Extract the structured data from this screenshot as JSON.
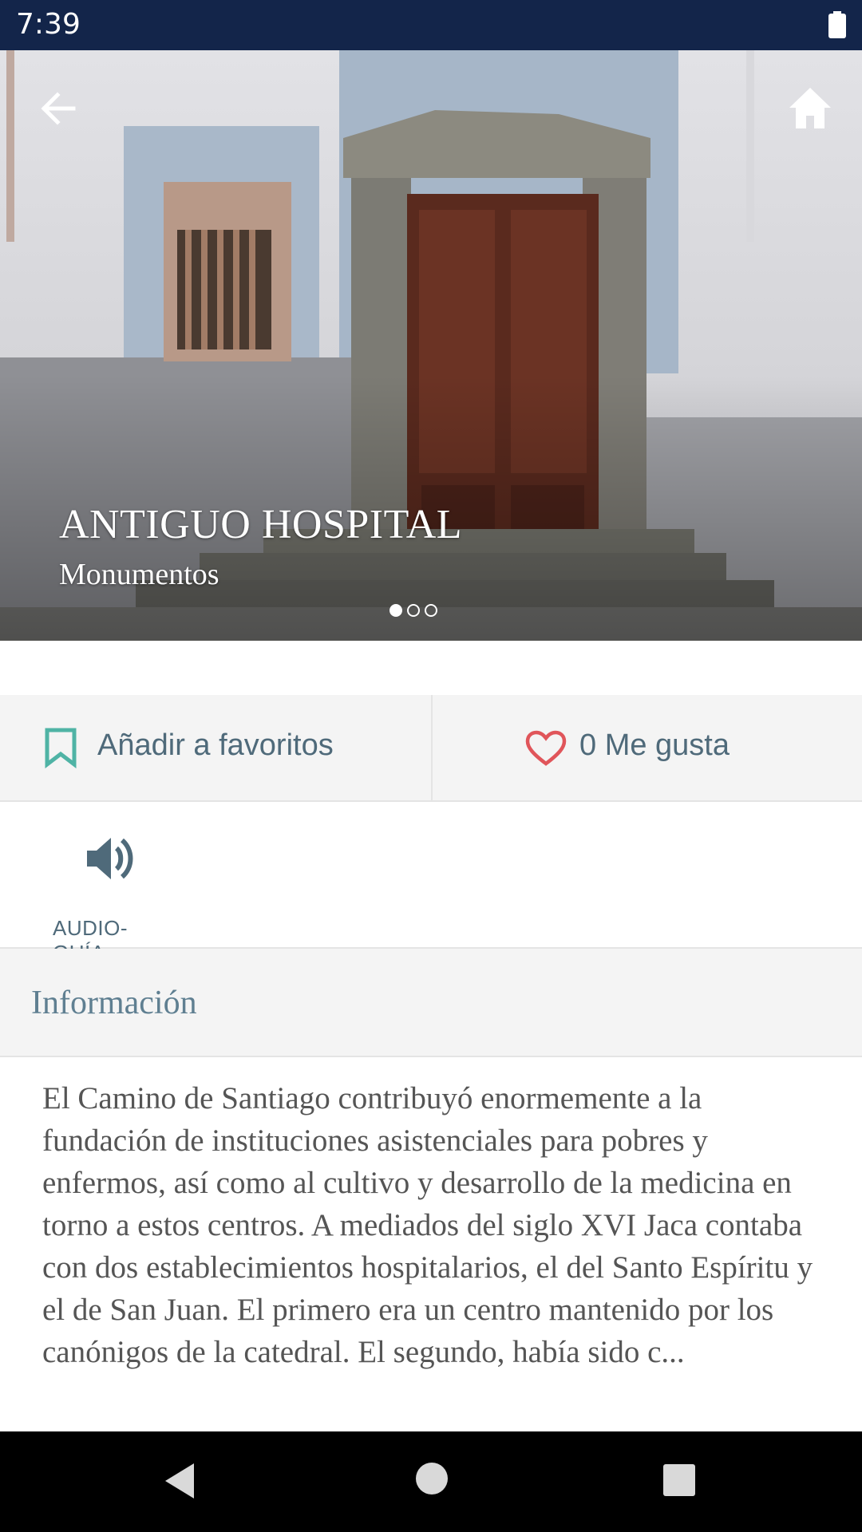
{
  "status_bar": {
    "time": "7:39"
  },
  "hero": {
    "title": "ANTIGUO HOSPITAL",
    "category": "Monumentos",
    "carousel": {
      "count": 3,
      "active": 1
    }
  },
  "actions": {
    "favorite_label": "Añadir a favoritos",
    "like_label": "0 Me gusta"
  },
  "audio": {
    "label": "AUDIO-GUÍA"
  },
  "info": {
    "heading": "Información",
    "text": "El Camino de Santiago contribuyó enormemente a la fundación de instituciones asistenciales para pobres y enfermos, así como al cultivo y desarrollo de la medicina en torno a estos centros. A mediados del siglo XVI Jaca contaba con dos establecimientos hospitalarios, el del Santo Espíritu y el de San Juan. El primero era un centro mantenido por los canónigos de la catedral. El segundo, había sido c..."
  },
  "colors": {
    "status_bar": "#13254a",
    "accent_teal": "#4fb3a5",
    "heart_red": "#e0555a",
    "label_slate": "#4f6a7a"
  },
  "icons": [
    "back-arrow-icon",
    "home-icon",
    "bookmark-icon",
    "heart-icon",
    "speaker-icon",
    "battery-icon"
  ]
}
